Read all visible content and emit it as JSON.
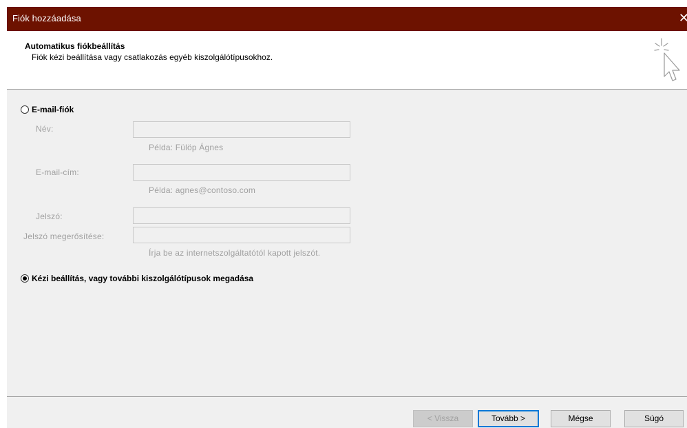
{
  "window": {
    "title": "Fiók hozzáadása",
    "close_glyph": "✕",
    "titlebar_color": "#6d1200"
  },
  "header": {
    "title": "Automatikus fiókbeállítás",
    "subtitle": "Fiók kézi beállítása vagy csatlakozás egyéb kiszolgálótípusokhoz.",
    "icon": "wizard-cursor-icon"
  },
  "email_option": {
    "label": "E-mail-fiók",
    "selected": false,
    "fields": {
      "name": {
        "label": "Név:",
        "value": "",
        "hint": "Példa: Fülöp Ágnes"
      },
      "email": {
        "label": "E-mail-cím:",
        "value": "",
        "hint": "Példa: agnes@contoso.com"
      },
      "password": {
        "label": "Jelszó:",
        "value": ""
      },
      "password_confirm": {
        "label": "Jelszó megerősítése:",
        "value": "",
        "hint": "Írja be az internetszolgáltatótól kapott jelszót."
      }
    }
  },
  "manual_option": {
    "label": "Kézi beállítás, vagy további kiszolgálótípusok megadása",
    "selected": true
  },
  "buttons": {
    "back": "< Vissza",
    "next": "Tovább >",
    "cancel": "Mégse",
    "help": "Súgó"
  }
}
